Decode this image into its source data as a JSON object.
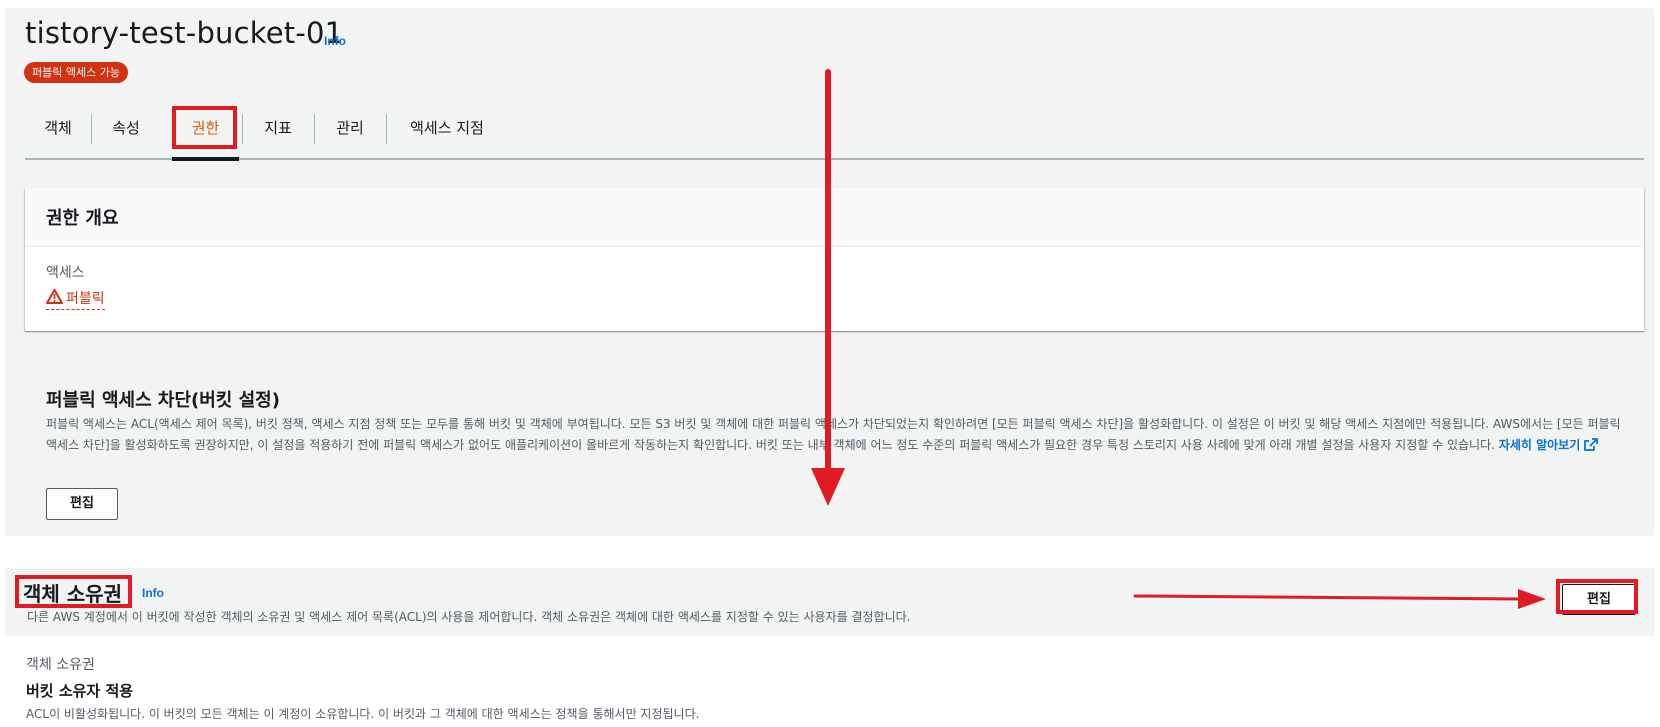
{
  "header": {
    "bucket_name": "tistory-test-bucket-01",
    "info_label": "Info",
    "public_badge": "퍼블릭 액세스 가능"
  },
  "tabs": [
    {
      "label": "객체"
    },
    {
      "label": "속성"
    },
    {
      "label": "권한",
      "active": true
    },
    {
      "label": "지표"
    },
    {
      "label": "관리"
    },
    {
      "label": "액세스 지점"
    }
  ],
  "overview": {
    "title": "권한 개요",
    "access_label": "액세스",
    "access_value": "퍼블릭",
    "access_icon": "warning-triangle-icon"
  },
  "block_public_access": {
    "title": "퍼블릭 액세스 차단(버킷 설정)",
    "description": "퍼블릭 액세스는 ACL(액세스 제어 목록), 버킷 정책, 액세스 지점 정책 또는 모두를 통해 버킷 및 객체에 부여됩니다. 모든 S3 버킷 및 객체에 대한 퍼블릭 액세스가 차단되었는지 확인하려면 [모든 퍼블릭 액세스 차단]을 활성화합니다. 이 설정은 이 버킷 및 해당 액세스 지점에만 적용됩니다. AWS에서는 [모든 퍼블릭 액세스 차단]을 활성화하도록 권장하지만, 이 설정을 적용하기 전에 퍼블릭 액세스가 없어도 애플리케이션이 올바르게 작동하는지 확인합니다. 버킷 또는 내부 객체에 어느 정도 수준의 퍼블릭 액세스가 필요한 경우 특정 스토리지 사용 사례에 맞게 아래 개별 설정을 사용자 지정할 수 있습니다.",
    "learn_more": "자세히 알아보기",
    "edit_label": "편집"
  },
  "object_ownership": {
    "title": "객체 소유권",
    "info_label": "Info",
    "description": "다른 AWS 계정에서 이 버킷에 작성한 객체의 소유권 및 액세스 제어 목록(ACL)의 사용을 제어합니다. 객체 소유권은 객체에 대한 액세스를 지정할 수 있는 사용자를 결정합니다.",
    "edit_label": "편집",
    "field_label": "객체 소유권",
    "field_value": "버킷 소유자 적용",
    "field_desc": "ACL이 비활성화됩니다. 이 버킷의 모든 객체는 이 계정이 소유합니다. 이 버킷과 그 객체에 대한 액세스는 정책을 통해서만 지정됩니다."
  },
  "colors": {
    "annotation_red": "#e01b24",
    "warning_red": "#d13212",
    "active_tab_orange": "#d45b07",
    "link_blue": "#0972d3"
  }
}
